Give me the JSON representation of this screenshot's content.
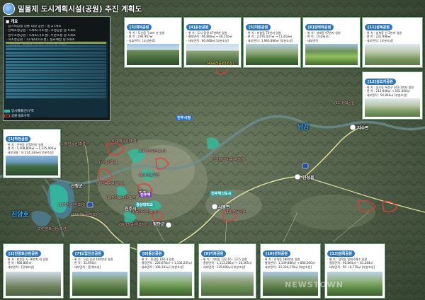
{
  "title": "밀몰제 도시계획시설(공원) 추진 계획도",
  "summary": {
    "heading": "■ 개요",
    "lines": [
      "- 장기미집행 일몰 대상 공원 : 총 27개소",
      "- 전체조성공원 : 5개소(기조성), 조성공원 중 5개소",
      "- 일부조성공원 : 5개소(기조성), 부분조성 중 5개소",
      "- 미조성공원 : 11개소(미조성), 실효예정 중 6개소",
      "- 기타공원 : 6개소(기조성), 나머지 중 6개소"
    ]
  },
  "map_legend": [
    {
      "label": "일시해제(안)구역",
      "color": "#2fbfa0"
    },
    {
      "label": "공원 실효구역",
      "color": "#e23b3b"
    }
  ],
  "cards": [
    {
      "title": "[1]하천공원",
      "lines": [
        "- 위    치 : 산천동 산72번지 일원",
        "- 면    적 : 1,408,809㎡ → 1,225,000㎡",
        "- 세부내용 : 보 214,333㎡ [부분조성]"
      ],
      "photo": "ph-f"
    },
    {
      "title": "[3]대덕공원",
      "lines": [
        "- 위    치 : 도산읍 구교리 산 일원",
        "- 면    적 : 196,967㎡",
        "- 실효면적 : [조성완료]"
      ],
      "photo": "ph-a"
    },
    {
      "title": "[4]공산공원",
      "lines": [
        "- 위    치 : 도시 일원 47만8천 일원",
        "- 결정면적 : 66,866㎡ → 48,216㎡",
        "- 세부면적 : 80,668㎡ [부분조성]"
      ],
      "photo": "ph-b"
    },
    {
      "title": "[5]미원공원",
      "lines": [
        "- 위    치 : 미원동 73번지 일원",
        "- 면    적 : 2,076,037㎡ → 11,418㎡",
        "- 세부면적 : 1,963,866㎡ [부분조성]"
      ],
      "photo": "ph-c"
    },
    {
      "title": "[6]성태화공원",
      "lines": [
        "- 위    치 : 성태동 97번지 일원",
        "- 면    적 : [조성완료]",
        "- 세부면적 :"
      ],
      "photo": "ph-d"
    },
    {
      "title": "[11]성북공원",
      "lines": [
        "- 위    치 : 성북동 산 2번지 일원",
        "- 면    적 : 231,998㎡",
        "- 세부면적 : [부분조성]"
      ],
      "photo": "ph-e"
    },
    {
      "title": "[12]성조지공원",
      "lines": [
        "- 위    치 : 성조동 특정구 162-1번지 일원",
        "- 면    적 : 215,848㎡ → 161,000㎡",
        "- 세부면적 : 54,848㎡ [부분조성]"
      ],
      "photo": "ph-e"
    },
    {
      "title": "[2]진양호근린공원",
      "lines": [
        "- 위    치 : 판문동 사 36번지 외 일원",
        "- 면    적 : 966,885㎡",
        "- 세부면적 : [전체조성]"
      ],
      "photo": "ph-g"
    },
    {
      "title": "[7]도립진선공원",
      "lines": [
        "- 위    치 : 도립 진선 100번지 일원",
        "- 면    적 : 32,656㎡",
        "- 세부면적 : [전체조성]"
      ],
      "photo": "ph-h"
    },
    {
      "title": "[8]동산공원",
      "lines": [
        "- 위    치 : 동산동 100-3 일원",
        "- 결정면적 : 226,678㎡ → 1,132,235㎡",
        "- 실효면적 : 108,191㎡ [부분조성]"
      ],
      "photo": "ph-i"
    },
    {
      "title": "[9]가좌공원",
      "lines": [
        "- 위    치 : 가좌동 122-16 · 12-5 일원",
        "- 결정면적 : 1,113,286㎡ → 18,365㎡",
        "- 세부면적 : 135,000㎡ [부분조성]"
      ],
      "photo": "ph-j"
    },
    {
      "title": "[10]선학공원",
      "lines": [
        "- 위    치 : 선학동 180번지 일원",
        "- 결정면적 : 1,149,886㎡ → 880,000㎡",
        "- 세부면적 : 33,334,279㎡ [부분조성]"
      ],
      "photo": "ph-h"
    },
    {
      "title": "[13]섬목공원",
      "lines": [
        "- 위    치 : 섬목동 일대 6개소 일원",
        "- 결정면적 : 56,864㎡ → 61,284㎡",
        "- 세부면적 : 50 +6,779㎡ [부분조성]"
      ],
      "photo": "ph-i"
    }
  ],
  "map_labels": [
    {
      "text": "(4)공산공원(조성)",
      "cls": "y"
    },
    {
      "text": "(11)성북공원",
      "cls": ""
    },
    {
      "text": "(12)성조지공원(조성)",
      "cls": ""
    },
    {
      "text": "(6)예재공원(조성)",
      "cls": ""
    },
    {
      "text": "(5)미원공원(조성)",
      "cls": ""
    },
    {
      "text": "(7)선학공원",
      "cls": ""
    },
    {
      "text": "(10)성조공원",
      "cls": ""
    },
    {
      "text": "(3)대덕공원(조성)",
      "cls": ""
    },
    {
      "text": "(2)진양호공원(조성)",
      "cls": ""
    },
    {
      "text": "(8)동산공원(조성)",
      "cls": ""
    },
    {
      "text": "(9)가좌공원(조성)",
      "cls": ""
    },
    {
      "text": "(13)섬목공원",
      "cls": ""
    },
    {
      "text": "(1)하천공원(조성)",
      "cls": ""
    },
    {
      "text": "(1)하천공원(조성)",
      "cls": ""
    },
    {
      "text": "(2)진양호공원(조성)",
      "cls": ""
    },
    {
      "text": "(13)대기공원(조성)",
      "cls": ""
    }
  ],
  "towns": [
    "산청군",
    "진주시",
    "진주시",
    "함안군",
    "진성읍",
    "지수면",
    "사봉면"
  ],
  "places": [
    "남강",
    "진양호"
  ],
  "badges": [
    {
      "text": "진주시청",
      "cls": ""
    },
    {
      "text": "진주역",
      "cls": "p"
    },
    {
      "text": "경상대학교",
      "cls": "t"
    },
    {
      "text": "진주혁신도시",
      "cls": "t"
    }
  ],
  "watermark": "NEWSTOWN"
}
